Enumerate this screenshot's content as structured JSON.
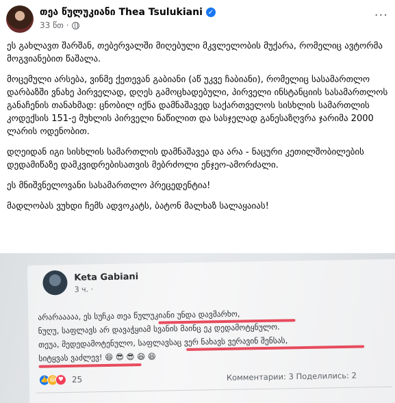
{
  "post": {
    "author": "თეა წულუკიანი Thea Tsulukiani",
    "time": "33 წთ ·",
    "paragraphs": [
      "ეს გახლავთ შარშან, თებერვალში მიღებული მკვლელობის მუქარა, რომელიც ავტორმა მოგვიანებით წაშალა.",
      "მოცემული არსება, ვინმე ქეთევან გაბიანი (აწ უკვე ჩაბიანი), რომელიც სასამართლო დარბაზში ვნახე პირველად, დღეს გამოცხადებული, პირველი ინსტანციის სასამართლოს განაჩენის თანახმად: ცნობილ იქნა დამნაშავედ საქართველოს სისხლის სამართლის კოდექსის 151-ე მუხლის პირველი ნაწილით და სასჯელად განესაზღვრა ჯარიმა 2000 ლარის ოდენობით.",
      "დღეიდან იგი სისხლის სამართლის დამნაშავეა და არა - ნაცური კეთილშობილების დედამიწაზე დამკვიდრებისათვის მებრძოლი ენჯეო-ამორძალი.",
      "ეს მნიშვნელოვანი სასამართლო პრეცედენტია!",
      "მადლობას ვუხდი ჩემს ადვოკატს, ბატონ მალხაზ სალაყაიას!"
    ],
    "more_label": "···",
    "verified_label": "✓"
  },
  "embedded": {
    "author": "Keta Gabiani",
    "time": "3 ч. ·",
    "lines": [
      "არარააააა, ეს სუჩკა თეა წულუკიანი უნდა დავმარხო,",
      "ნუღუ, საფლავს არ დავაჭყიამ სვანის მაინც ეკ დედამოტყნულო.",
      "თეუა, მედედამოტენულო, საფლავსაც ვერ ნახავს ვერავინ შენსას,",
      "სიტყვას ვაძლევ! 😆 😎 😎 😆 😆"
    ],
    "reaction_count": "25",
    "stats": "Комментарии: 3   Поделились: 2"
  },
  "colors": {
    "underline": "#e63a4d",
    "verified": "#1877f2"
  }
}
